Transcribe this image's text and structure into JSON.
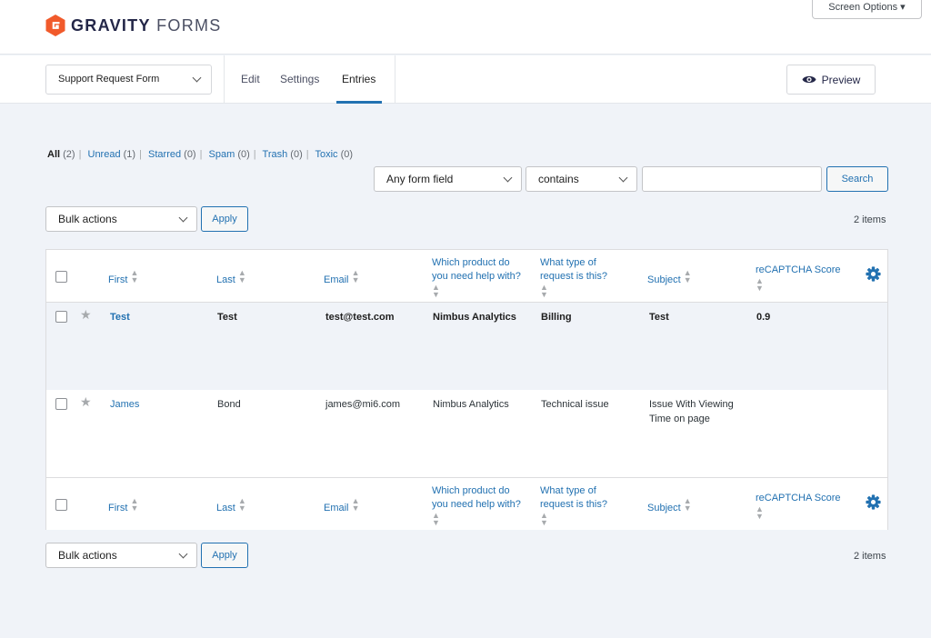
{
  "brand": {
    "bold": "GRAVITY",
    "light": "FORMS",
    "color": "#f15a2b"
  },
  "screen_options": "Screen Options",
  "toolbar": {
    "form_select": "Support Request Form",
    "tabs": [
      {
        "label": "Edit"
      },
      {
        "label": "Settings"
      },
      {
        "label": "Entries",
        "active": true
      }
    ],
    "preview_label": "Preview"
  },
  "filters": {
    "all": {
      "label": "All",
      "count": "(2)"
    },
    "unread": {
      "label": "Unread",
      "count": "(1)"
    },
    "starred": {
      "label": "Starred",
      "count": "(0)"
    },
    "spam": {
      "label": "Spam",
      "count": "(0)"
    },
    "trash": {
      "label": "Trash",
      "count": "(0)"
    },
    "toxic": {
      "label": "Toxic",
      "count": "(0)"
    },
    "separator": "|"
  },
  "search": {
    "field": "Any form field",
    "operator": "contains",
    "query": "",
    "button": "Search"
  },
  "bulk": {
    "label": "Bulk actions",
    "apply": "Apply"
  },
  "items_count": "2 items",
  "columns": {
    "first": "First",
    "last": "Last",
    "email": "Email",
    "product_l1": "Which product do",
    "product_l2": "you need help with?",
    "type_l1": "What type of",
    "type_l2": "request is this?",
    "subject": "Subject",
    "recaptcha": "reCAPTCHA Score"
  },
  "rows": [
    {
      "first": "Test",
      "last": "Test",
      "email": "test@test.com",
      "product": "Nimbus Analytics",
      "type": "Billing",
      "subject_l1": "Test",
      "subject_l2": "",
      "score": "0.9",
      "unread": true
    },
    {
      "first": "James",
      "last": "Bond",
      "email": "james@mi6.com",
      "product": "Nimbus Analytics",
      "type": "Technical issue",
      "subject_l1": "Issue With Viewing",
      "subject_l2": "Time on page",
      "score": "",
      "unread": false
    }
  ],
  "icons": {
    "star": "star-icon",
    "gear": "gear-icon",
    "eye": "eye-icon",
    "sort": "sort-icon",
    "chevron": "chevron-down-icon"
  },
  "colors": {
    "link": "#2271b1",
    "accent": "#2271b1"
  }
}
